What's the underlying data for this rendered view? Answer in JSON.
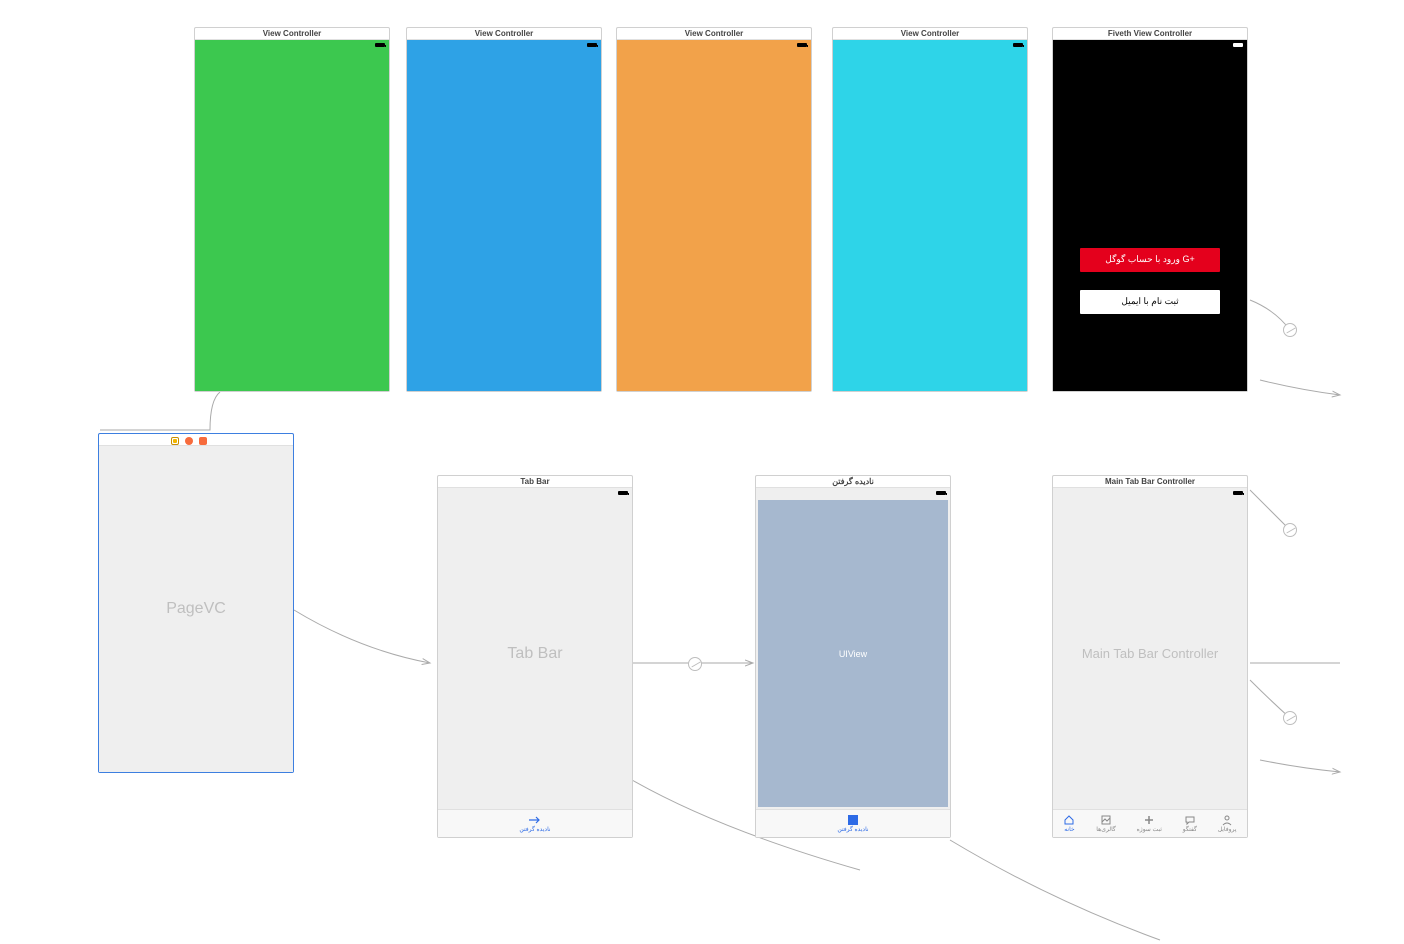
{
  "top_scenes": [
    {
      "title": "View Controller",
      "bg": "#3cc84f"
    },
    {
      "title": "View Controller",
      "bg": "#2ea2e6"
    },
    {
      "title": "View Controller",
      "bg": "#f2a24a"
    },
    {
      "title": "View Controller",
      "bg": "#2ed4e8"
    }
  ],
  "login_scene": {
    "title": "Fiveth View Controller",
    "google_btn": "ورود با حساب گوگل  G+",
    "email_btn": "ثبت نام با ایمیل"
  },
  "pagevc": {
    "label": "PageVC"
  },
  "tabbar_scene": {
    "title": "Tab Bar",
    "label": "Tab Bar",
    "tab_label": "نادیده گرفتن"
  },
  "ignored_scene": {
    "title": "نادیده گرفتن",
    "body_label": "UIView",
    "tab_label": "نادیده گرفتن"
  },
  "main_tab_scene": {
    "title": "Main Tab Bar Controller",
    "label": "Main Tab Bar Controller",
    "tabs": [
      {
        "name": "home",
        "label": "خانه",
        "active": true
      },
      {
        "name": "gallery",
        "label": "گالری‌ها",
        "active": false
      },
      {
        "name": "add",
        "label": "ثبت سوژه",
        "active": false
      },
      {
        "name": "chat",
        "label": "گفتگو",
        "active": false
      },
      {
        "name": "profile",
        "label": "پروفایل",
        "active": false
      }
    ]
  }
}
